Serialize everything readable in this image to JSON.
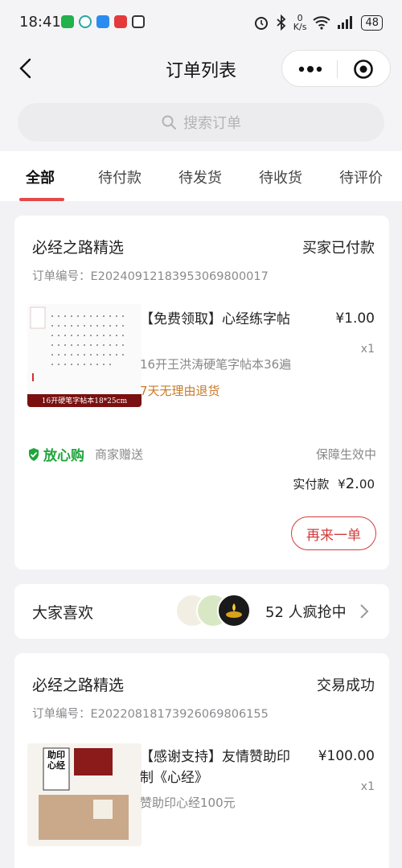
{
  "status_bar": {
    "time": "18:41",
    "net_speed_value": "0",
    "net_speed_unit": "K/s",
    "battery": "48"
  },
  "nav": {
    "title": "订单列表"
  },
  "search": {
    "placeholder": "搜索订单"
  },
  "tabs": [
    {
      "label": "全部",
      "active": true
    },
    {
      "label": "待付款",
      "active": false
    },
    {
      "label": "待发货",
      "active": false
    },
    {
      "label": "待收货",
      "active": false
    },
    {
      "label": "待评价",
      "active": false
    }
  ],
  "orders": [
    {
      "store": "必经之路精选",
      "status": "买家已付款",
      "order_no": "订单编号：E20240912183953069800017",
      "product_name": "【免费领取】心经练字帖",
      "price": "¥1.00",
      "qty": "x1",
      "spec": "16开王洪涛硬笔字帖本36遍",
      "refund": "7天无理由退货",
      "thumb_banner": "16开硬笔字帖本18*25cm",
      "guard": {
        "label": "放心购",
        "sub": "商家赠送",
        "right": "保障生效中"
      },
      "paid_label": "实付款",
      "paid_currency": "¥",
      "paid_amount": "2.",
      "paid_decimals": "00",
      "reorder": "再来一单"
    },
    {
      "store": "必经之路精选",
      "status": "交易成功",
      "order_no": "订单编号：E20220818173926069806155",
      "product_name_line1": "【感谢支持】友情赞助印",
      "product_name_line2": "制《心经》",
      "price": "¥100.00",
      "qty": "x1",
      "spec": "赞助印心经100元",
      "thumb_label": "助印心经"
    }
  ],
  "like": {
    "title": "大家喜欢",
    "count_text": "52 人疯抢中"
  },
  "colors": {
    "accent": "#e14a4a",
    "guard_green": "#1fa53b",
    "refund_orange": "#c97b2a"
  }
}
